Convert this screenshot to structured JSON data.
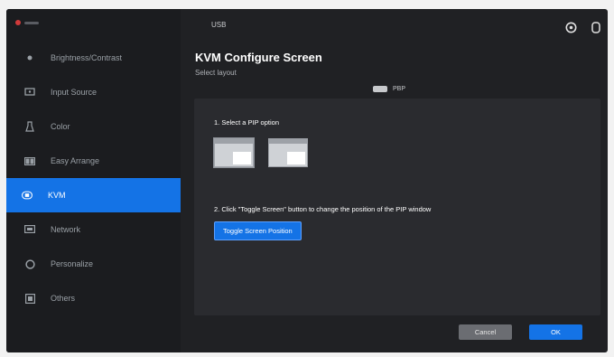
{
  "app": {
    "top_label": "USB"
  },
  "sidebar": {
    "items": [
      {
        "label": "Brightness/Contrast",
        "icon": "sun-icon"
      },
      {
        "label": "Input Source",
        "icon": "input-source-icon"
      },
      {
        "label": "Color",
        "icon": "color-icon"
      },
      {
        "label": "Easy Arrange",
        "icon": "grid-icon"
      },
      {
        "label": "KVM",
        "icon": "kvm-icon"
      },
      {
        "label": "Network",
        "icon": "network-icon"
      },
      {
        "label": "Personalize",
        "icon": "personalize-icon"
      },
      {
        "label": "Others",
        "icon": "others-icon"
      }
    ],
    "active_index": 4
  },
  "page": {
    "title": "KVM Configure Screen",
    "subtitle": "Select layout",
    "toggle_label": "PBP"
  },
  "panel": {
    "step1": "1. Select a PIP option",
    "step2": "2. Click \"Toggle Screen\" button to change the position of the PIP window",
    "toggle_button": "Toggle Screen Position"
  },
  "footer": {
    "cancel": "Cancel",
    "ok": "OK"
  },
  "colors": {
    "accent": "#1473e6",
    "background": "#202124",
    "sidebar": "#1b1c1f"
  }
}
